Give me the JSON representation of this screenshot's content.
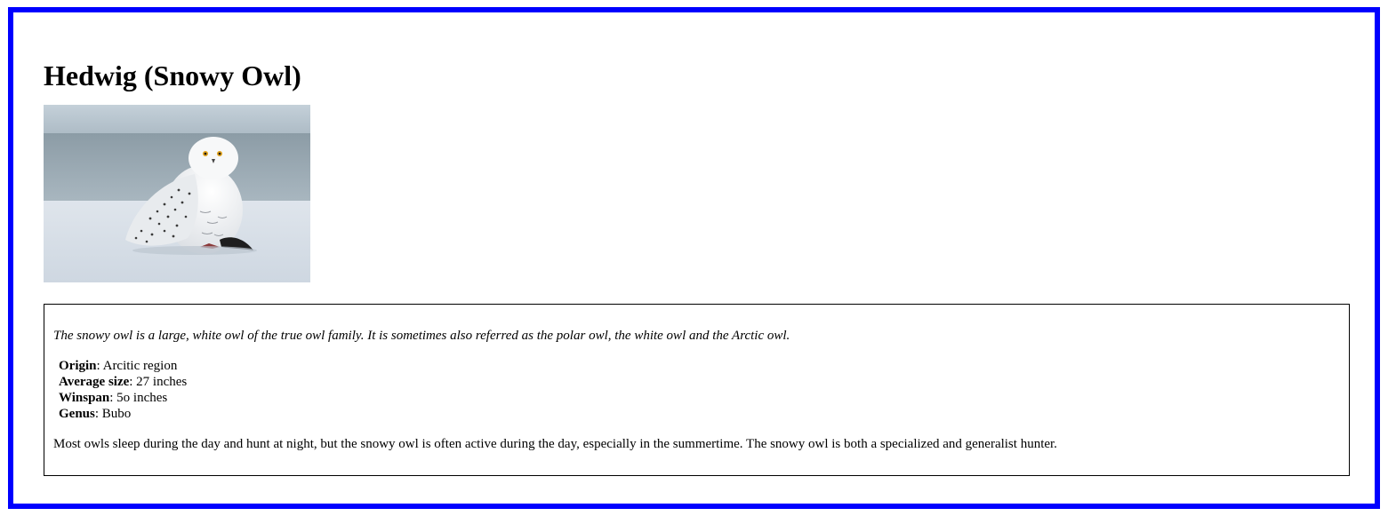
{
  "title": "Hedwig (Snowy Owl)",
  "image": {
    "subject": "snowy owl perched on snow"
  },
  "description": {
    "intro": "The snowy owl is a large, white owl of the true owl family. It is sometimes also referred as the polar owl, the white owl and the Arctic owl.",
    "facts": [
      {
        "label": "Origin",
        "value": ": Arcitic region"
      },
      {
        "label": "Average size",
        "value": ": 27 inches"
      },
      {
        "label": "Winspan",
        "value": ": 5o inches"
      },
      {
        "label": "Genus",
        "value": ": Bubo"
      }
    ],
    "summary": "Most owls sleep during the day and hunt at night, but the snowy owl is often active during the day, especially in the summertime. The snowy owl is both a specialized and generalist hunter."
  },
  "colors": {
    "frame_border": "#0000ff",
    "box_border": "#000000",
    "text": "#000000",
    "background": "#ffffff"
  }
}
